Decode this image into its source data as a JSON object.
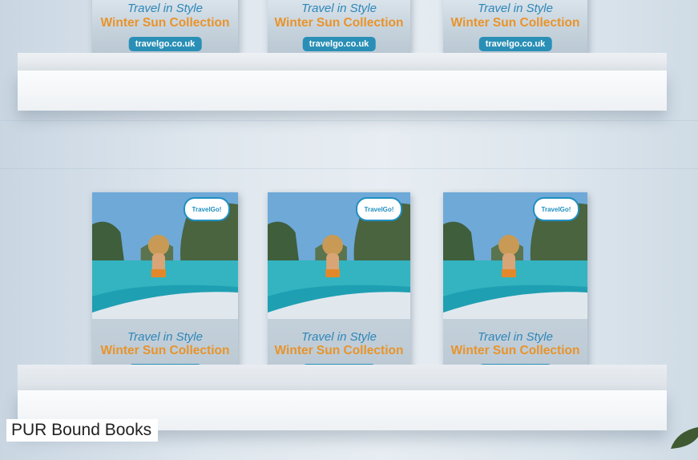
{
  "book": {
    "tagline": "Travel in Style",
    "collection": "Winter Sun Collection",
    "url": "travelgo.co.uk",
    "logo": "TravelGo!"
  },
  "caption": "PUR Bound Books",
  "colors": {
    "tagline": "#2e86b8",
    "collection": "#e9932a",
    "url_badge": "#2a8fb6"
  }
}
